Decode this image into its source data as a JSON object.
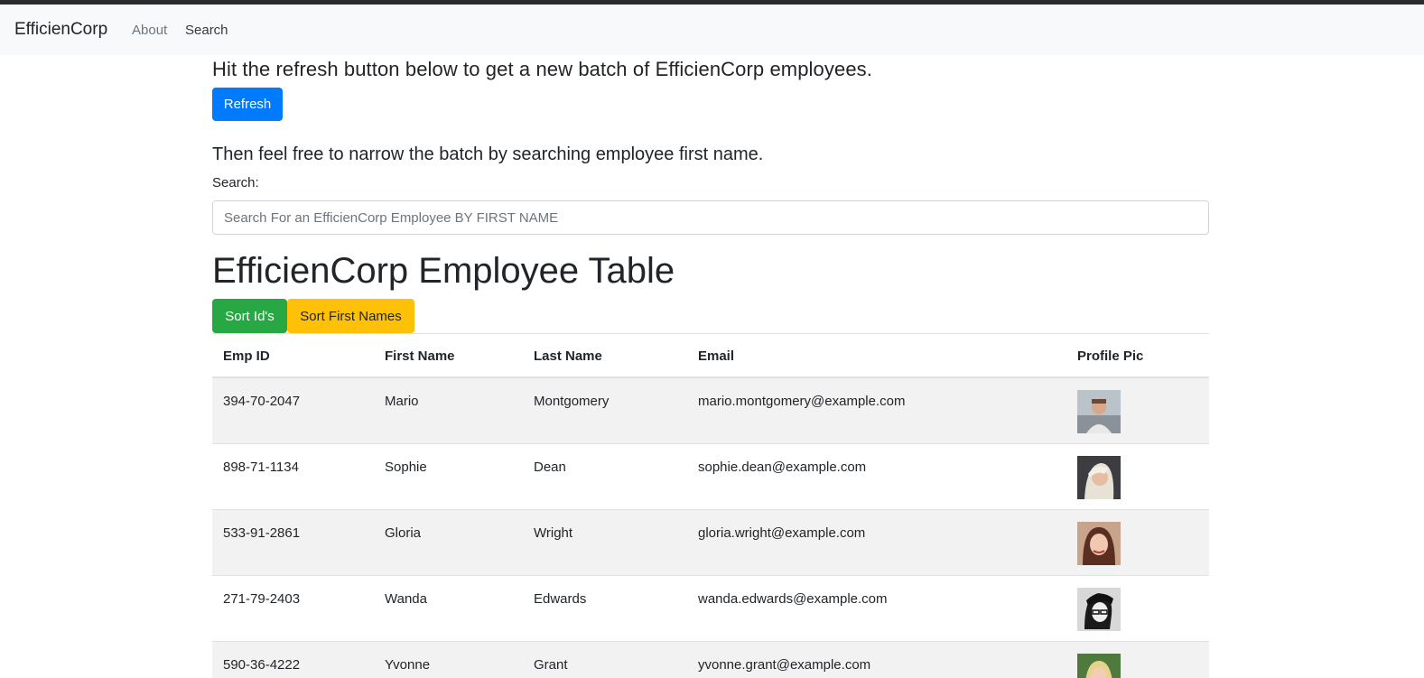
{
  "navbar": {
    "brand": "EfficienCorp",
    "links": [
      "About",
      "Search"
    ]
  },
  "intro": {
    "text": "Hit the refresh button below to get a new batch of EfficienCorp employees.",
    "refresh_label": "Refresh"
  },
  "search": {
    "instruction": "Then feel free to narrow the batch by searching employee first name.",
    "label": "Search:",
    "placeholder": "Search For an EfficienCorp Employee BY FIRST NAME",
    "value": ""
  },
  "table": {
    "title": "EfficienCorp Employee Table",
    "sort_ids_label": "Sort Id's",
    "sort_names_label": "Sort First Names",
    "headers": [
      "Emp ID",
      "First Name",
      "Last Name",
      "Email",
      "Profile Pic"
    ],
    "rows": [
      {
        "id": "394-70-2047",
        "first": "Mario",
        "last": "Montgomery",
        "email": "mario.montgomery@example.com",
        "pic": "profile-photo-icon"
      },
      {
        "id": "898-71-1134",
        "first": "Sophie",
        "last": "Dean",
        "email": "sophie.dean@example.com",
        "pic": "profile-photo-icon"
      },
      {
        "id": "533-91-2861",
        "first": "Gloria",
        "last": "Wright",
        "email": "gloria.wright@example.com",
        "pic": "profile-photo-icon"
      },
      {
        "id": "271-79-2403",
        "first": "Wanda",
        "last": "Edwards",
        "email": "wanda.edwards@example.com",
        "pic": "profile-photo-icon"
      },
      {
        "id": "590-36-4222",
        "first": "Yvonne",
        "last": "Grant",
        "email": "yvonne.grant@example.com",
        "pic": "profile-photo-icon"
      }
    ]
  },
  "colors": {
    "primary": "#007bff",
    "success": "#28a745",
    "warning": "#ffc107",
    "navbar_bg": "#f8f9fa",
    "stripe": "#f2f2f2"
  }
}
